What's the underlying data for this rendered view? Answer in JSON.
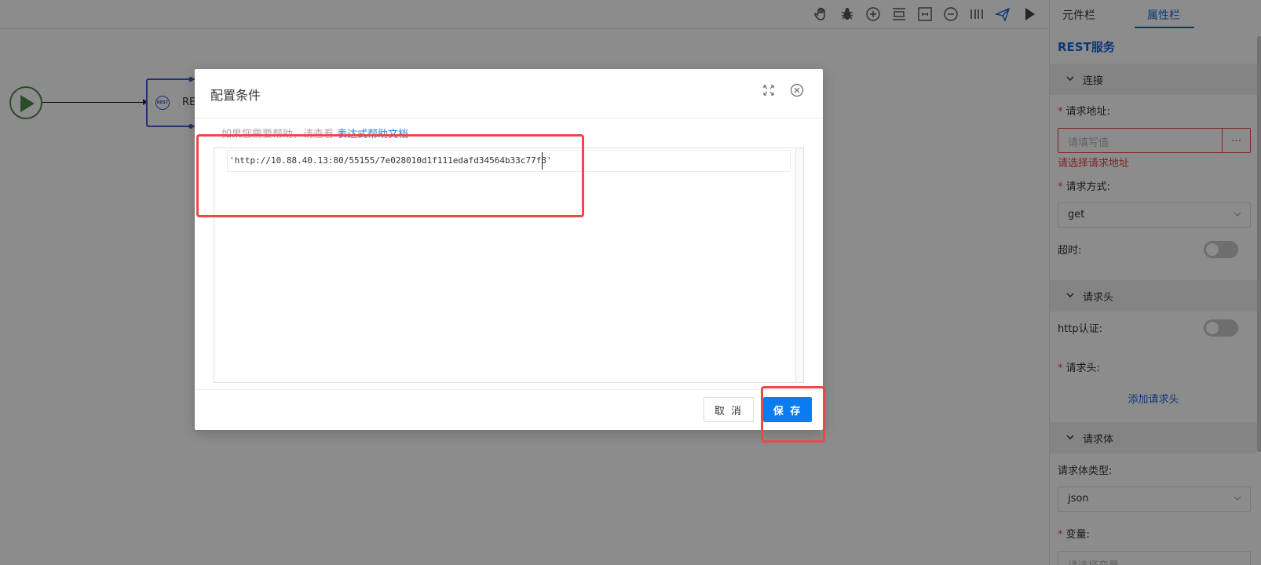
{
  "canvas": {
    "node_label": "RE",
    "node_icon_text": "REST"
  },
  "panel": {
    "tabs": [
      "元件栏",
      "属性栏"
    ],
    "active_tab": "属性栏",
    "title": "REST服务",
    "sections": {
      "connection": {
        "title": "连接",
        "url_label": "请求地址:",
        "url_placeholder": "请填写值",
        "url_button": "...",
        "url_error": "请选择请求地址",
        "method_label": "请求方式:",
        "method_value": "get",
        "timeout_label": "超时:"
      },
      "headers": {
        "title": "请求头",
        "auth_label": "http认证:",
        "header_label": "请求头:",
        "add_link": "添加请求头"
      },
      "body": {
        "title": "请求体",
        "type_label": "请求体类型:",
        "type_value": "json",
        "var_label": "变量:",
        "var_placeholder": "请选择变量"
      }
    }
  },
  "dialog": {
    "title": "配置条件",
    "help_prefix": "如果您需要帮助，请查看",
    "help_link": "表达式帮助文档",
    "code": "'http://10.88.40.13:80/55155/7e028010d1f111edafd34564b33c77f3'",
    "cancel_label": "取 消",
    "save_label": "保 存"
  },
  "colors": {
    "accent": "#1667d9",
    "primary_button": "#0a7cf2",
    "error": "#e64545",
    "annotation": "#e84a4a",
    "start_node": "#4d8a4d"
  },
  "icons": [
    "hand-icon",
    "bug-icon",
    "zoom-in-icon",
    "align-icon",
    "fit-icon",
    "zoom-out-icon",
    "distribute-icon",
    "send-icon",
    "play-icon"
  ]
}
